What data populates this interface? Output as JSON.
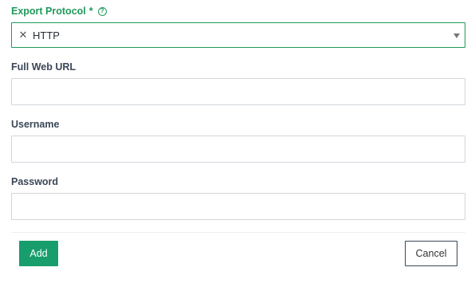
{
  "export_protocol": {
    "label": "Export Protocol",
    "required_marker": "*",
    "help_icon": "question-circle-icon",
    "selected_value": "HTTP",
    "clear_icon": "close-icon",
    "caret_icon": "caret-down-icon"
  },
  "full_web_url": {
    "label": "Full Web URL",
    "value": "",
    "placeholder": ""
  },
  "username": {
    "label": "Username",
    "value": "",
    "placeholder": ""
  },
  "password": {
    "label": "Password",
    "value": "",
    "placeholder": ""
  },
  "actions": {
    "add_label": "Add",
    "cancel_label": "Cancel"
  },
  "colors": {
    "accent": "#1e9a5a",
    "primary_button": "#179e6c",
    "label_text": "#3b4656",
    "border": "#d2d6dc"
  }
}
